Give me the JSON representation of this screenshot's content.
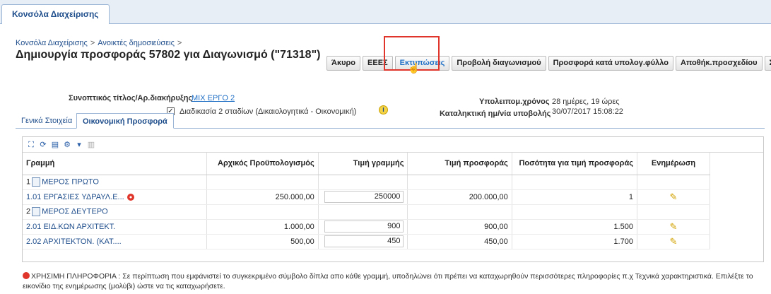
{
  "app_tab": "Κονσόλα Διαχείρισης",
  "breadcrumb": [
    "Κονσόλα Διαχείρισης",
    "Ανοικτές δημοσιεύσεις"
  ],
  "page_title": "Δημιουργία προσφοράς 57802 για Διαγωνισμό (\"71318\")",
  "buttons": [
    "Άκυρο",
    "ΕΕΕΣ",
    "Εκτυπώσεις",
    "Προβολή διαγωνισμού",
    "Προσφορά κατά υπολογ.φύλλο",
    "Αποθήκ.προσχεδίου",
    "Συνέχεια"
  ],
  "info": {
    "title_label": "Συνοπτικός τίτλος/Αρ.διακήρυξης",
    "title_value": "ΜΙΧ ΕΡΓΟ 2",
    "checkbox_label": "Διαδικασία 2 σταδίων (Δικαιολογητικά - Οικονομική)",
    "checkbox_checked": true,
    "remaining_label": "Υπολειπομ.χρόνος",
    "remaining_value": "28 ημέρες, 19 ώρες",
    "deadline_label": "Καταληκτική ημ/νία υποβολής",
    "deadline_value": "30/07/2017 15:08:22"
  },
  "subtabs": [
    "Γενικά Στοιχεία",
    "Οικονομική Προσφορά"
  ],
  "table": {
    "headers": [
      "Γραμμή",
      "Αρχικός Προϋπολογισμός",
      "Τιμή γραμμής",
      "Τιμή προσφοράς",
      "Ποσότητα για τιμή προσφοράς",
      "Ενημέρωση"
    ],
    "rows": [
      {
        "type": "group",
        "num": "1",
        "label": "ΜΕΡΟΣ ΠΡΩΤΟ"
      },
      {
        "type": "line",
        "label": "1.01 ΕΡΓΑΣΙΕΣ ΥΔΡΑΥΛ.Ε...",
        "warn": true,
        "budget": "250.000,00",
        "line_price": "250000",
        "offer_price": "200.000,00",
        "qty": "1"
      },
      {
        "type": "group",
        "num": "2",
        "label": "ΜΕΡΟΣ ΔΕΥΤΕΡΟ"
      },
      {
        "type": "line",
        "label": "2.01 ΕΙΔ.ΚΩΝ ΑΡΧΙΤΕΚΤ.",
        "warn": false,
        "budget": "1.000,00",
        "line_price": "900",
        "offer_price": "900,00",
        "qty": "1.500"
      },
      {
        "type": "line",
        "label": "2.02 ΑΡΧΙΤΕΚΤΟΝ. (ΚΑΤ....",
        "warn": false,
        "budget": "500,00",
        "line_price": "450",
        "offer_price": "450,00",
        "qty": "1.700"
      }
    ]
  },
  "footer_note": "ΧΡΗΣΙΜΗ ΠΛΗΡΟΦΟΡΙΑ : Σε περίπτωση που εμφάνιστεί το συγκεκριμένο σύμβολο δίπλα απο κάθε γραμμή, υποδηλώνει ότι πρέπει να καταχωρηθούν περισσότερες πληροφορίες π.χ Τεχνικά χαρακτηριστικά. Επιλέξτε το εικονίδιο της ενημέρωσης (μολύβι) ώστε να τις καταχωρήσετε."
}
